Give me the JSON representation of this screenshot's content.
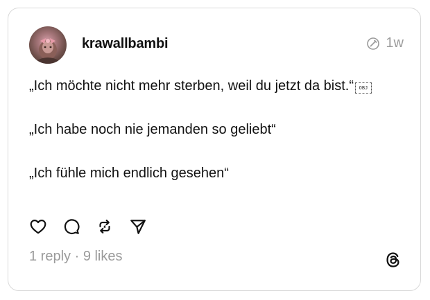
{
  "post": {
    "username": "krawallbambi",
    "time_label": "1w",
    "text_lines": [
      "„Ich möchte nicht mehr sterben, weil du jetzt da bist.“",
      "„Ich habe noch nie jemanden so geliebt“",
      "„Ich fühle mich endlich gesehen“"
    ],
    "obj_placeholder": "OBJ",
    "stats": {
      "replies": "1 reply",
      "separator": " · ",
      "likes": "9 likes"
    }
  },
  "icons": {
    "edited": "edited-pencil-circle-icon",
    "like": "heart-icon",
    "reply": "comment-bubble-icon",
    "repost": "repost-arrows-icon",
    "share": "send-icon",
    "brand": "threads-logo-icon"
  },
  "colors": {
    "text": "#111111",
    "muted": "#9a9a9a",
    "border": "#d9d9d9"
  }
}
